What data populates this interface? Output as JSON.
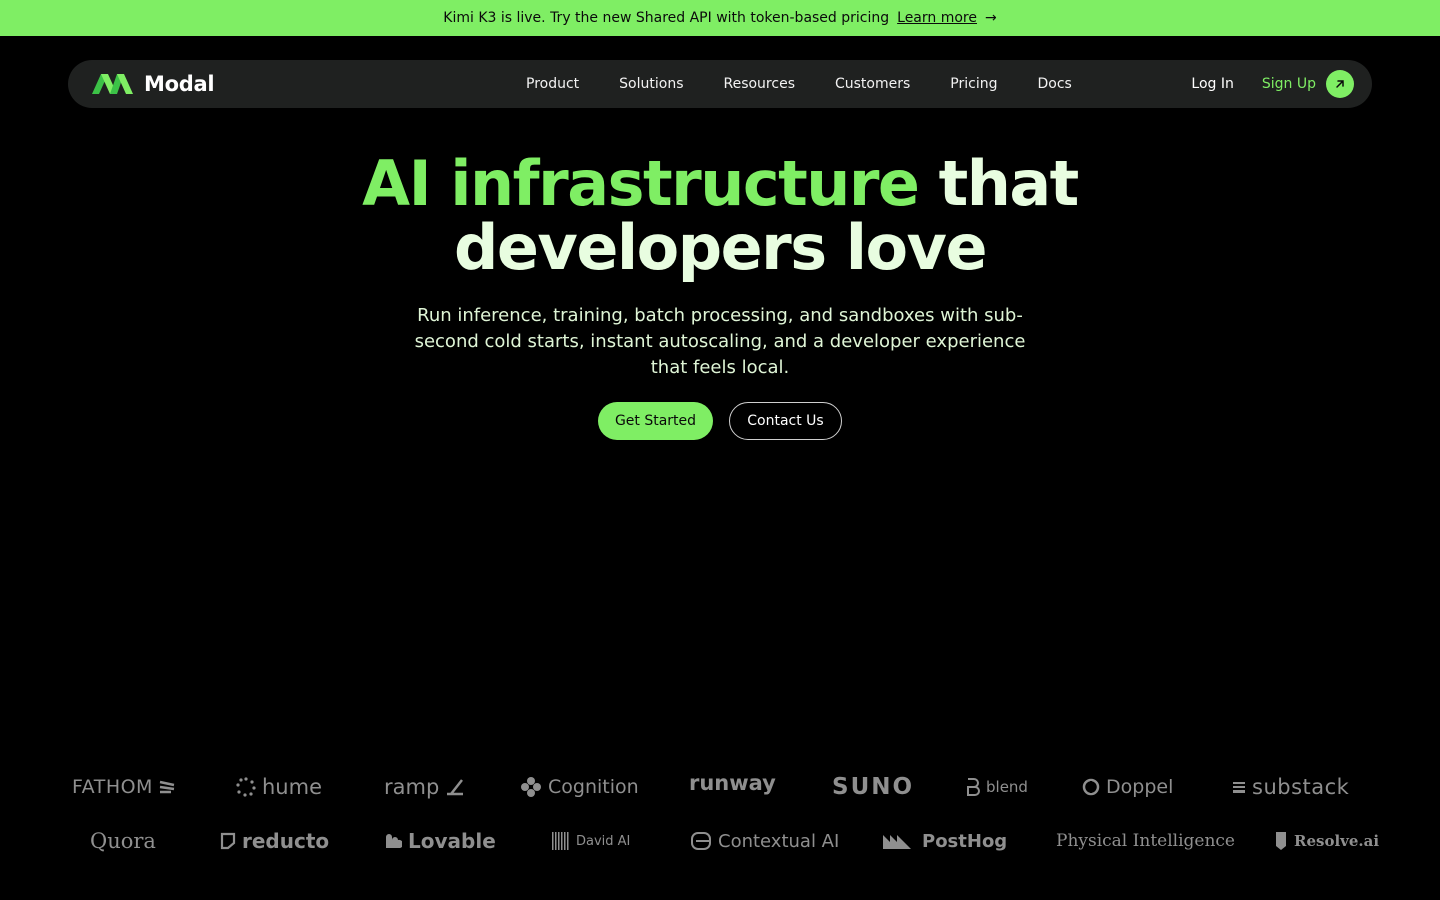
{
  "banner": {
    "text": "Kimi K3 is live. Try the new Shared API with token-based pricing",
    "link": "Learn more",
    "arrow": "→"
  },
  "nav": {
    "brand": "Modal",
    "links": [
      "Product",
      "Solutions",
      "Resources",
      "Customers",
      "Pricing",
      "Docs"
    ],
    "login": "Log In",
    "signup": "Sign Up"
  },
  "hero": {
    "title_green": "AI infrastructure",
    "title_rest": " that",
    "title_line2": "developers love",
    "subtitle": "Run inference, training, batch processing, and sandboxes with sub-second cold starts, instant autoscaling, and a developer experience that feels local.",
    "cta_primary": "Get Started",
    "cta_secondary": "Contact Us"
  },
  "customers": {
    "row1": [
      "FATHOM",
      "hume",
      "ramp",
      "Cognition",
      "runway",
      "SUNO",
      "blend",
      "Doppel",
      "substack"
    ],
    "row2": [
      "Quora",
      "reducto",
      "Lovable",
      "David AI",
      "Contextual AI",
      "PostHog",
      "Physical Intelligence",
      "Resolve.ai"
    ]
  },
  "colors": {
    "accent": "#7fee64",
    "nav_bg": "#1f2120",
    "logo_gray": "#8f8f8f"
  }
}
